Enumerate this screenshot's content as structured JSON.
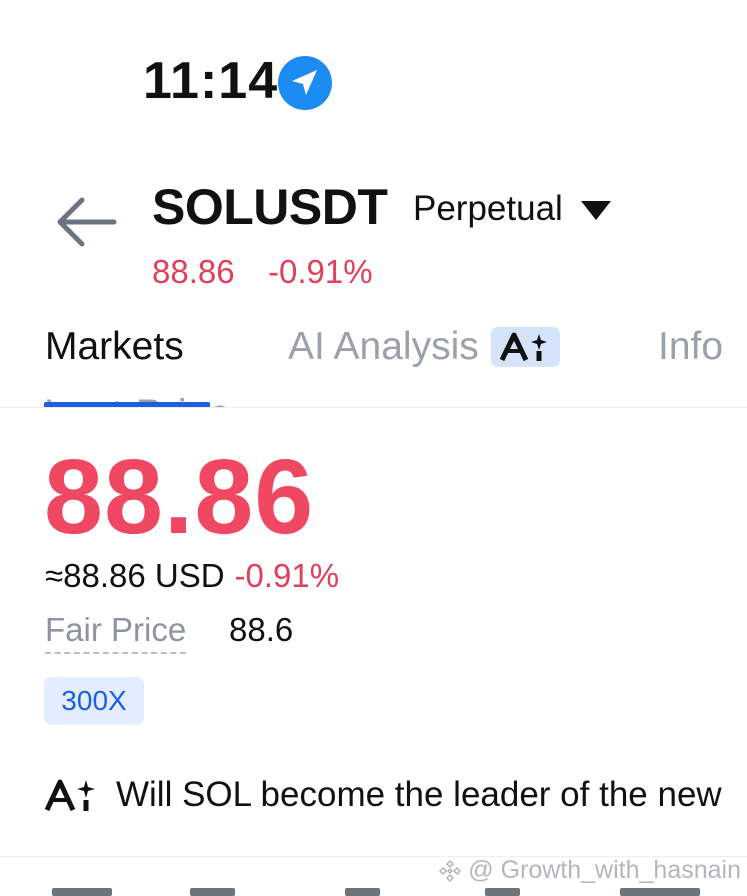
{
  "status_bar": {
    "time": "11:14",
    "icon": "location-arrow-icon"
  },
  "header": {
    "symbol": "SOLUSDT",
    "contract_type": "Perpetual",
    "price": "88.86",
    "change": "-0.91%"
  },
  "tabs": [
    {
      "label": "Markets",
      "active": true
    },
    {
      "label": "AI Analysis",
      "active": false,
      "icon": "ai-sparkle-icon"
    },
    {
      "label": "Info",
      "active": false
    }
  ],
  "price_block": {
    "last_price_label": "Last Price",
    "last_price": "88.86",
    "usd_value": "≈88.86 USD",
    "usd_change": "-0.91%",
    "fair_price_label": "Fair Price",
    "fair_price": "88.6",
    "leverage": "300X"
  },
  "ai_question": {
    "icon": "ai-sparkle-icon",
    "text": "Will SOL become the leader of the new"
  },
  "watermark": {
    "text": "@ Growth_with_hasnain"
  },
  "colors": {
    "negative": "#f04862",
    "accent": "#1c5fe0",
    "badge_bg": "#e3edfd",
    "muted_text": "#9aa1aa"
  }
}
